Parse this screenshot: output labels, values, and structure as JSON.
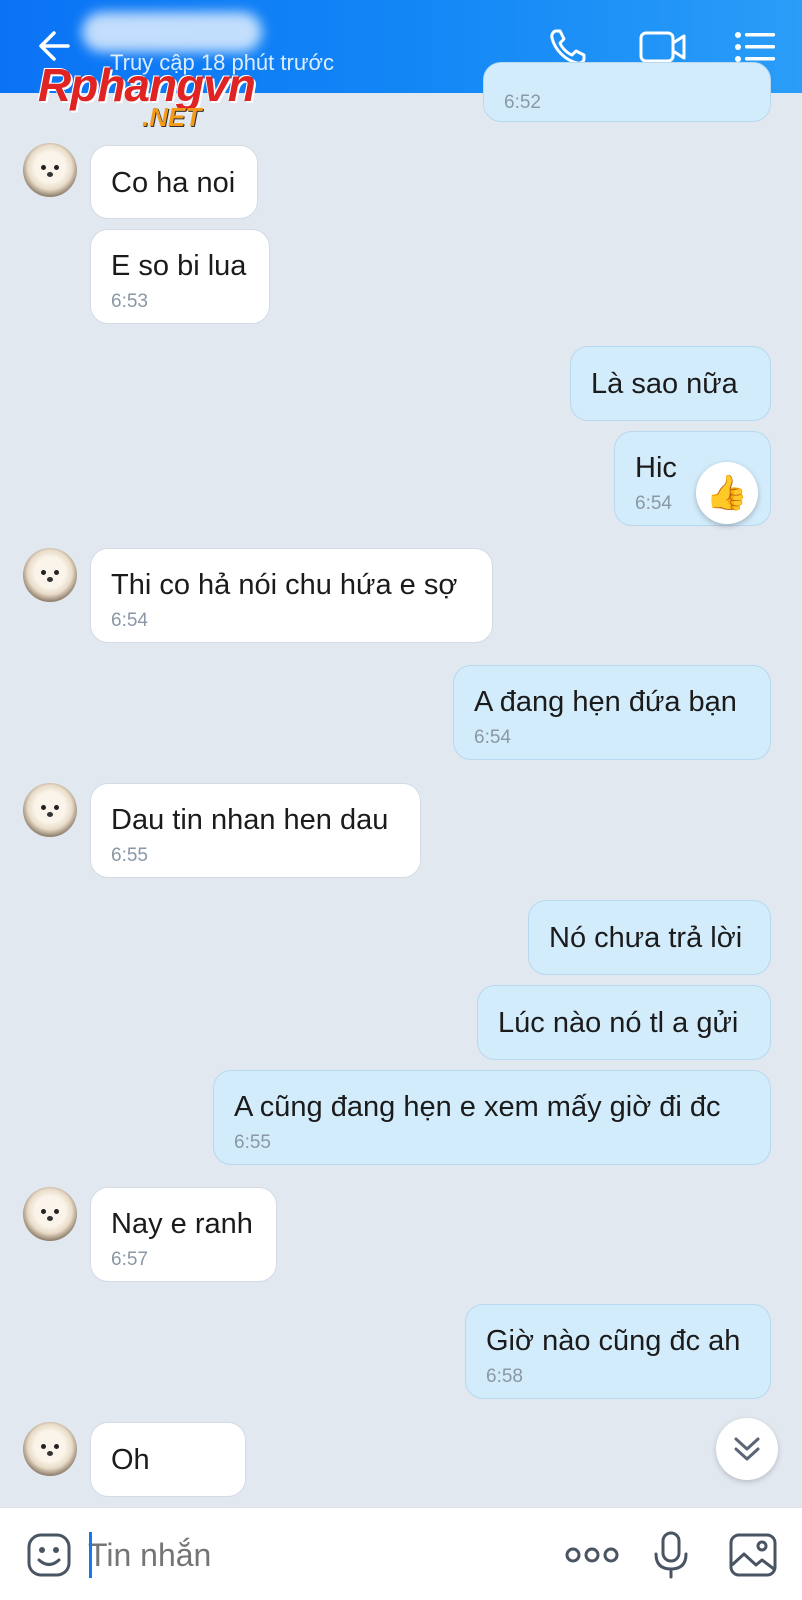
{
  "header": {
    "status": "Truy cập 18 phút trước",
    "watermark_main": "Rphangvn",
    "watermark_sub": ".NET",
    "icons": [
      "back-arrow-icon",
      "phone-icon",
      "video-call-icon",
      "menu-icon"
    ]
  },
  "messages": [
    {
      "side": "out",
      "text": "",
      "time": "6:52"
    },
    {
      "side": "in",
      "text": "Co ha noi",
      "time": ""
    },
    {
      "side": "in",
      "text": "E so bi lua",
      "time": "6:53"
    },
    {
      "side": "out",
      "text": "Là sao nữa",
      "time": ""
    },
    {
      "side": "out",
      "text": "Hic",
      "time": "6:54",
      "reaction": "👍"
    },
    {
      "side": "in",
      "text": "Thi co hả nói chu hứa e sợ",
      "time": "6:54"
    },
    {
      "side": "out",
      "text": "A đang hẹn đứa bạn",
      "time": "6:54"
    },
    {
      "side": "in",
      "text": "Dau tin nhan hen dau",
      "time": "6:55"
    },
    {
      "side": "out",
      "text": "Nó chưa trả lời",
      "time": ""
    },
    {
      "side": "out",
      "text": "Lúc nào nó tl a gửi",
      "time": ""
    },
    {
      "side": "out",
      "text": "A cũng đang hẹn e xem mấy giờ đi đc",
      "time": "6:55"
    },
    {
      "side": "in",
      "text": "Nay e ranh",
      "time": "6:57"
    },
    {
      "side": "out",
      "text": "Giờ nào cũng đc ah",
      "time": "6:58"
    },
    {
      "side": "in",
      "text": "Oh",
      "time": ""
    }
  ],
  "composer": {
    "placeholder": "Tin nhắn",
    "icons": [
      "sticker-icon",
      "more-icon",
      "microphone-icon",
      "image-icon"
    ]
  },
  "colors": {
    "header_start": "#0a73f5",
    "header_end": "#2a9df8",
    "chat_background": "#e2e8f0",
    "incoming_bubble": "#ffffff",
    "outgoing_bubble": "#d3ecfc",
    "accent": "#1478f2"
  }
}
